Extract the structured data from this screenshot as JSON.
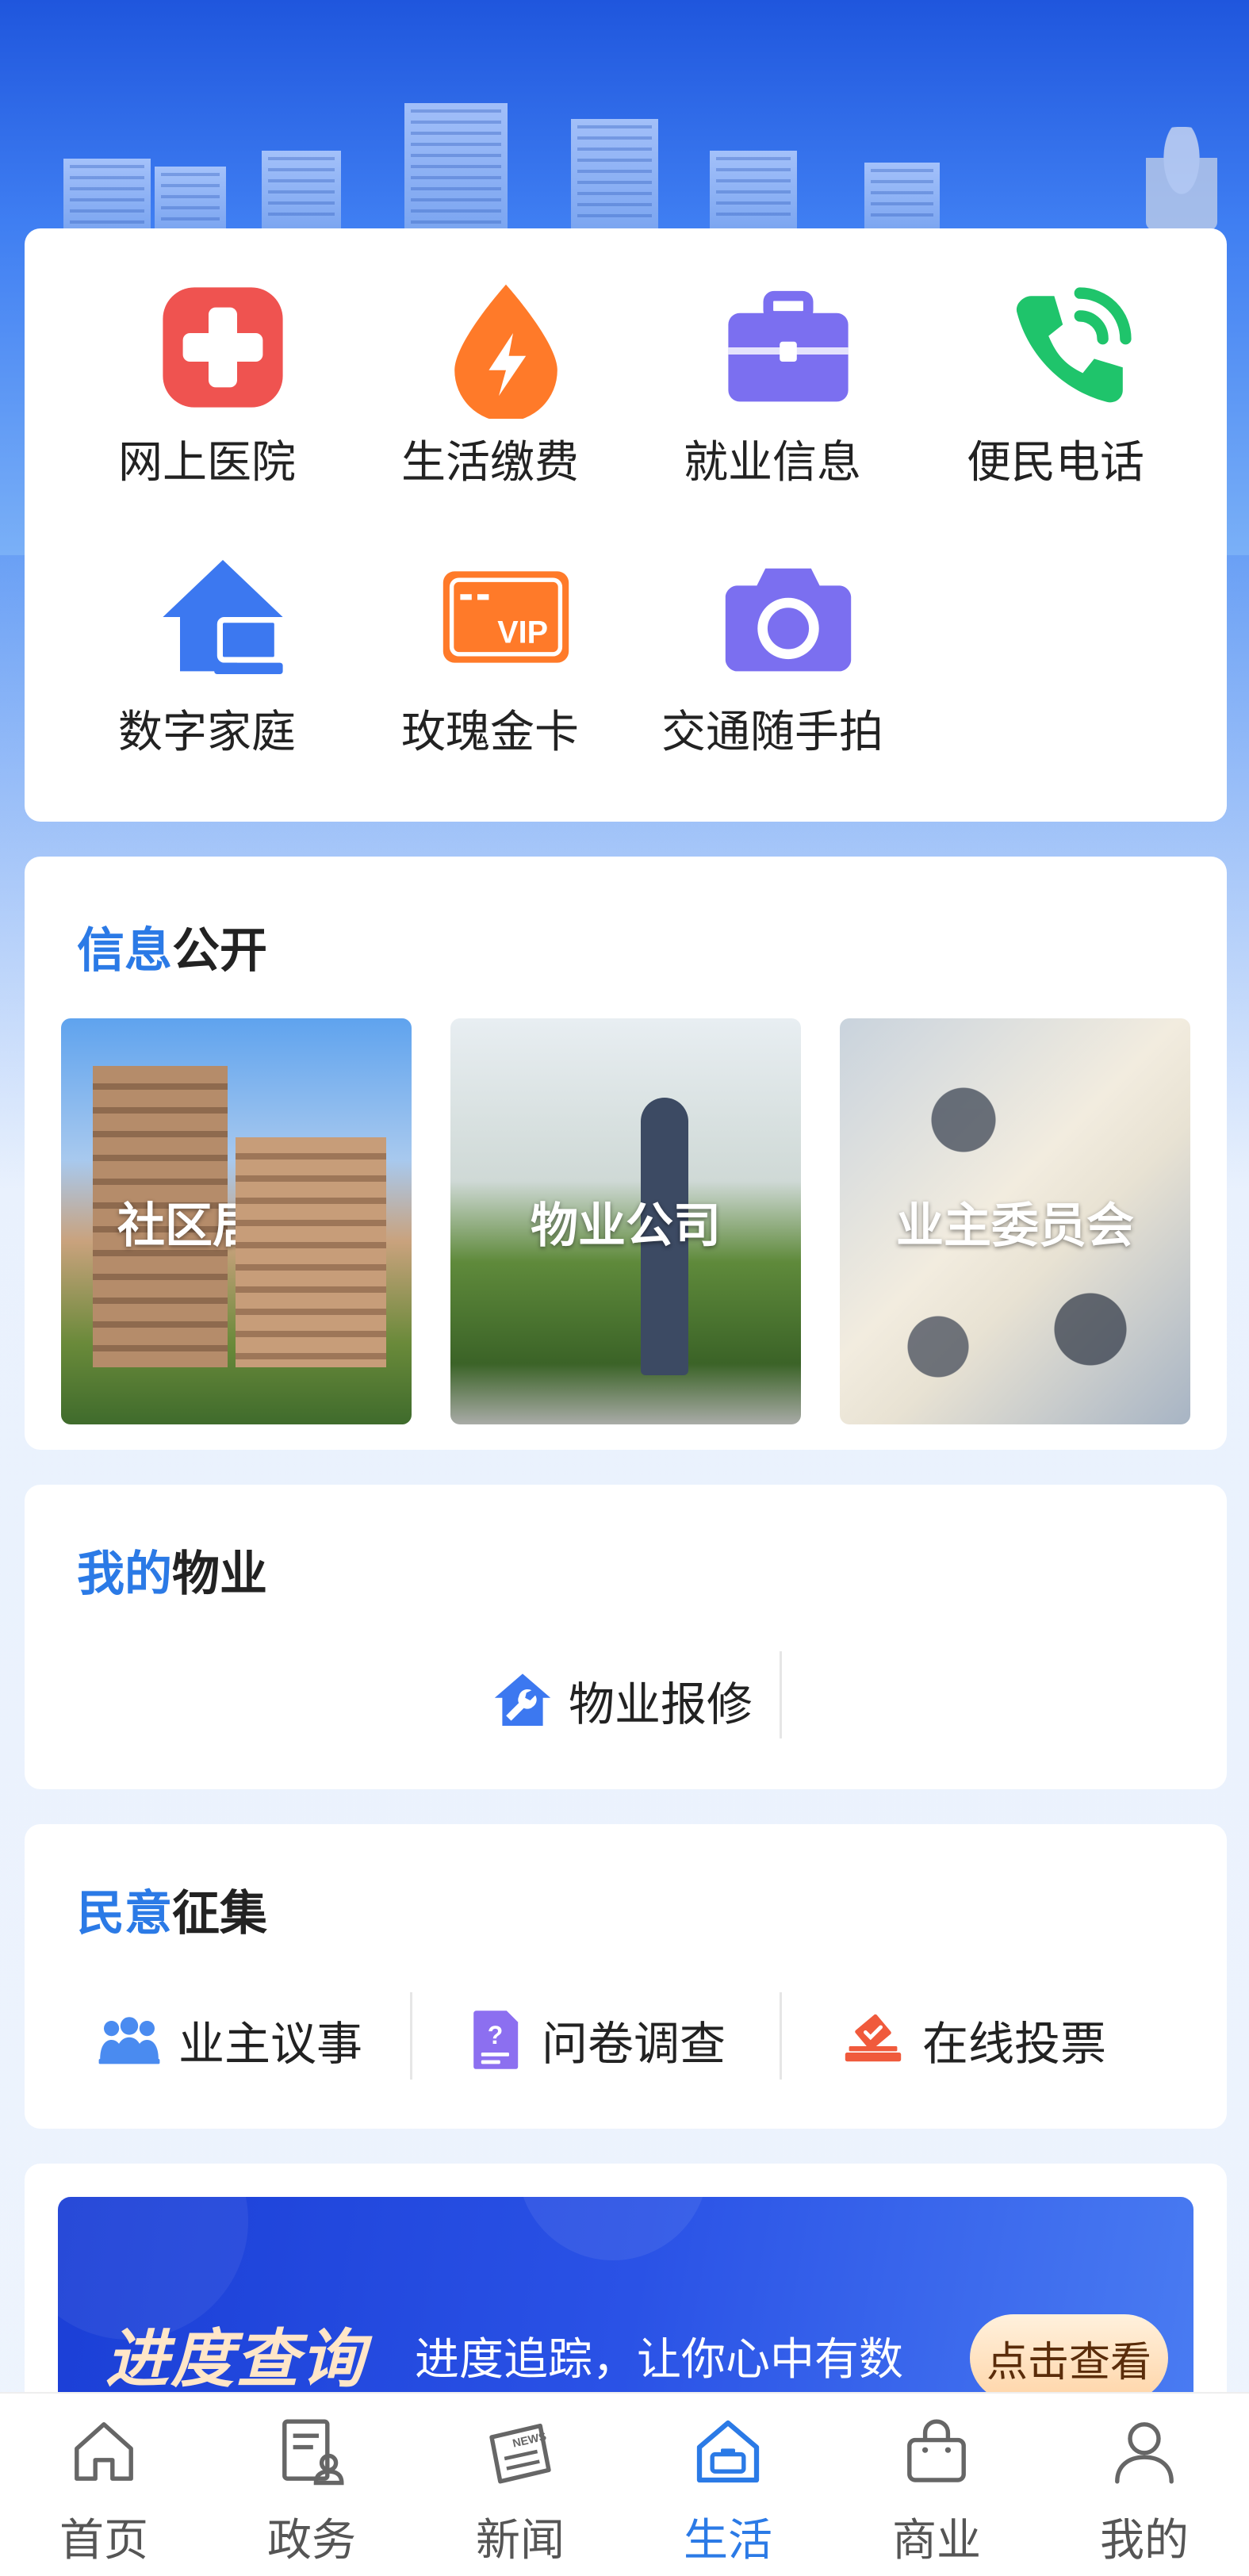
{
  "services": [
    {
      "label": "网上医院",
      "icon": "hospital-cross-icon",
      "color": "#ef5350"
    },
    {
      "label": "生活缴费",
      "icon": "lightning-drop-icon",
      "color": "#ff7a29"
    },
    {
      "label": "就业信息",
      "icon": "briefcase-icon",
      "color": "#7b6ff0"
    },
    {
      "label": "便民电话",
      "icon": "phone-icon",
      "color": "#1fc46b"
    },
    {
      "label": "数字家庭",
      "icon": "home-computer-icon",
      "color": "#3c78f0"
    },
    {
      "label": "玫瑰金卡",
      "icon": "vip-card-icon",
      "color": "#ff7a29"
    },
    {
      "label": "交通随手拍",
      "icon": "camera-icon",
      "color": "#7b6ff0"
    }
  ],
  "info_section": {
    "title_hl": "信息",
    "title_rest": "公开",
    "tiles": [
      {
        "label": "社区居委会"
      },
      {
        "label": "物业公司"
      },
      {
        "label": "业主委员会"
      }
    ]
  },
  "property_section": {
    "title_hl": "我的",
    "title_rest": "物业",
    "items": [
      {
        "label": "物业报修",
        "icon": "house-wrench-icon"
      }
    ]
  },
  "opinion_section": {
    "title_hl": "民意",
    "title_rest": "征集",
    "items": [
      {
        "label": "业主议事",
        "icon": "people-group-icon"
      },
      {
        "label": "问卷调查",
        "icon": "questionnaire-icon"
      },
      {
        "label": "在线投票",
        "icon": "ballot-box-icon"
      }
    ]
  },
  "progress_banner": {
    "title": "进度查询",
    "subtitle": "进度追踪，让你心中有数",
    "button": "点击查看"
  },
  "tabbar": {
    "active": "生活",
    "accent": "#2b7ae6",
    "tabs": [
      {
        "label": "首页",
        "icon": "home-icon"
      },
      {
        "label": "政务",
        "icon": "government-doc-icon"
      },
      {
        "label": "新闻",
        "icon": "newspaper-icon"
      },
      {
        "label": "生活",
        "icon": "life-icon"
      },
      {
        "label": "商业",
        "icon": "shopping-bag-icon"
      },
      {
        "label": "我的",
        "icon": "user-icon"
      }
    ]
  }
}
